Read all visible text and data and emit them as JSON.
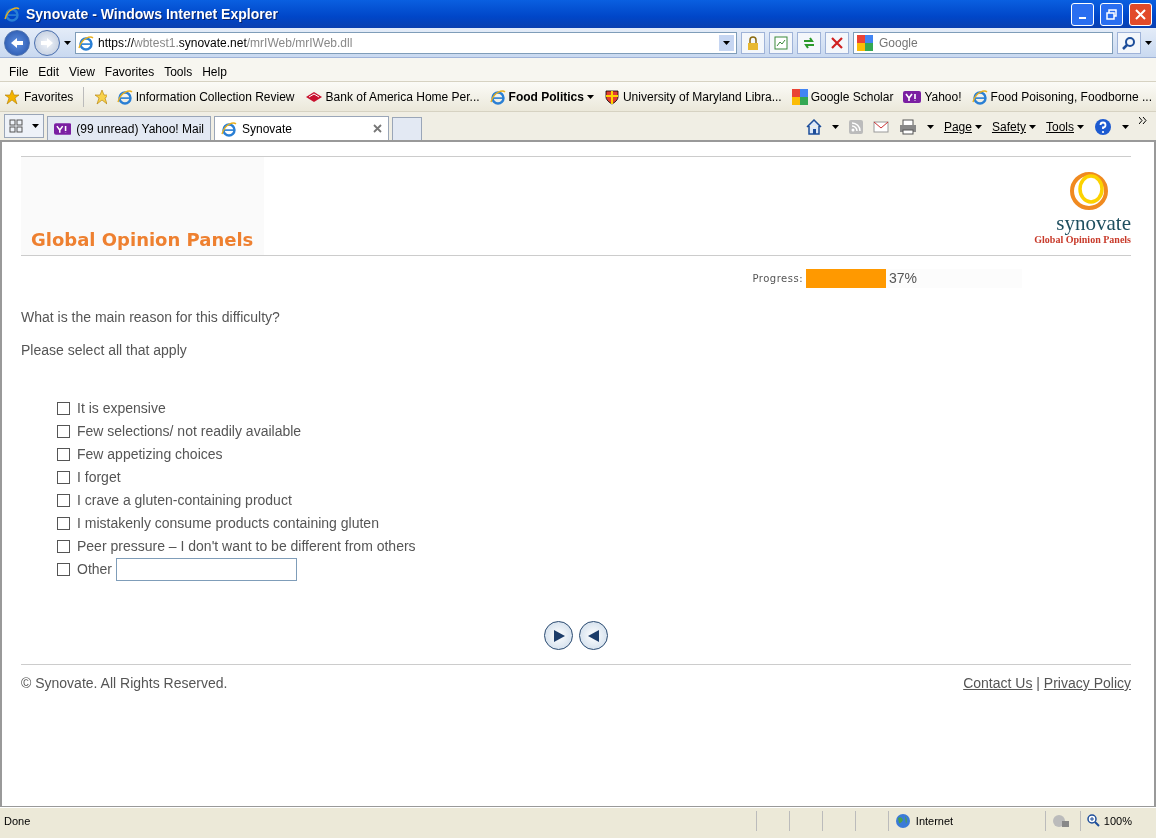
{
  "window": {
    "title": "Synovate - Windows Internet Explorer"
  },
  "address_bar": {
    "scheme": "https://",
    "host_prefix": "wbtest1.",
    "host": "synovate.net",
    "path": "/mrIWeb/mrIWeb.dll"
  },
  "search": {
    "placeholder": "Google"
  },
  "menu": [
    "File",
    "Edit",
    "View",
    "Favorites",
    "Tools",
    "Help"
  ],
  "favorites": {
    "label": "Favorites",
    "links": [
      {
        "label": "Information Collection Review",
        "bold": false,
        "dropdown": false
      },
      {
        "label": "Bank of America  Home  Per...",
        "bold": false,
        "dropdown": false
      },
      {
        "label": "Food Politics",
        "bold": true,
        "dropdown": true
      },
      {
        "label": "University of Maryland Libra...",
        "bold": false,
        "dropdown": false
      },
      {
        "label": "Google Scholar",
        "bold": false,
        "dropdown": false
      },
      {
        "label": "Yahoo!",
        "bold": false,
        "dropdown": false
      },
      {
        "label": "Food Poisoning, Foodborne ...",
        "bold": false,
        "dropdown": false
      }
    ]
  },
  "tabs": [
    {
      "label": "(99 unread) Yahoo! Mail",
      "selected": false
    },
    {
      "label": "Synovate",
      "selected": true
    }
  ],
  "command_bar": [
    "Page",
    "Safety",
    "Tools"
  ],
  "page": {
    "brand_title": "Global Opinion Panels",
    "logo_name": "synovate",
    "logo_tagline": "Global Opinion Panels",
    "progress": {
      "label": "Progress:",
      "level": 0.37,
      "reading": "37%"
    },
    "question": "What is the main reason for this difficulty?",
    "instruction": "Please select all that apply",
    "options": [
      {
        "kind": "checkbox",
        "label": "It is expensive",
        "checked": false
      },
      {
        "kind": "checkbox",
        "label": "Few selections/ not readily available",
        "checked": false
      },
      {
        "kind": "checkbox",
        "label": "Few appetizing choices",
        "checked": false
      },
      {
        "kind": "checkbox",
        "label": "I forget",
        "checked": false
      },
      {
        "kind": "checkbox",
        "label": "I crave a gluten-containing product",
        "checked": false
      },
      {
        "kind": "checkbox",
        "label": "I mistakenly consume products containing gluten",
        "checked": false
      },
      {
        "kind": "checkbox",
        "label": "Peer pressure – I don't want to be different from others",
        "checked": false
      },
      {
        "kind": "other",
        "label": "Other",
        "checked": false
      }
    ],
    "copyright": "© Synovate. All Rights Reserved.",
    "footer_links": [
      "Contact Us",
      "Privacy Policy"
    ],
    "footer_separator": "|"
  },
  "status_bar": {
    "status": "Done",
    "zone": "Internet",
    "zoom": "100%"
  }
}
